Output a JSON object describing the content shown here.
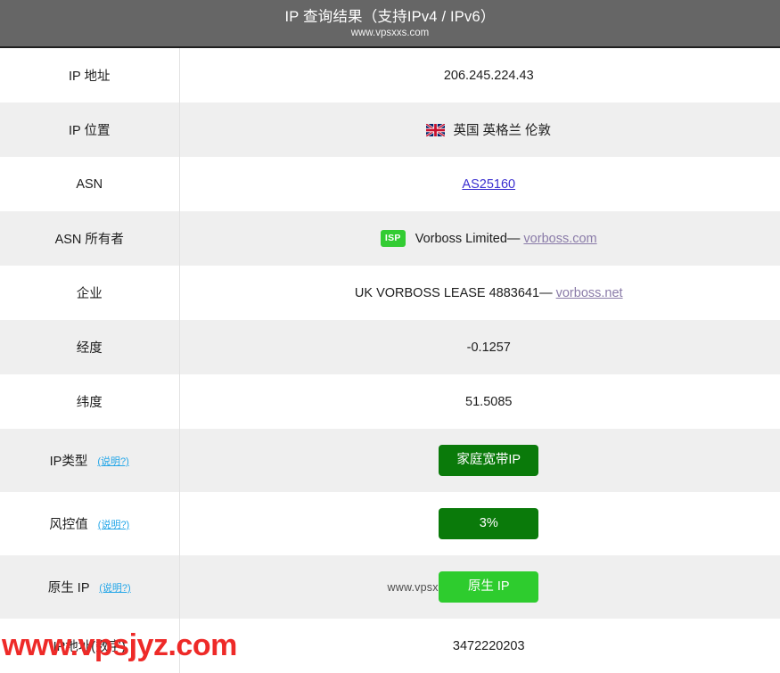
{
  "header": {
    "title": "IP 查询结果（支持IPv4 / IPv6）",
    "subtitle": "www.vpsxxs.com",
    "bg_color": "#666666",
    "title_color": "#ffffff"
  },
  "colors": {
    "row_odd": "#ffffff",
    "row_even": "#efefef",
    "divider": "#e2e2e2",
    "link_asn": "#3b2fd0",
    "link_visited": "#8a7ba8",
    "note_link": "#23a6e8",
    "badge_isp_green": "#33cc33",
    "badge_dark_green": "#0a7a0a",
    "badge_bright_green": "#2ecc2e",
    "watermark_red": "#ee2a28",
    "watermark_gray": "#4d4d4d"
  },
  "note_label": "(说明?)",
  "rows": {
    "ip_address": {
      "label": "IP 地址",
      "value": "206.245.224.43"
    },
    "ip_location": {
      "label": "IP 位置",
      "value": "英国 英格兰 伦敦",
      "flag_icon": "uk-flag-icon"
    },
    "asn": {
      "label": "ASN",
      "value": "AS25160"
    },
    "asn_owner": {
      "label": "ASN 所有者",
      "badge": "ISP",
      "value": "Vorboss Limited—",
      "link": "vorboss.com"
    },
    "organization": {
      "label": "企业",
      "value": "UK VORBOSS LEASE 4883641—",
      "link": "vorboss.net"
    },
    "longitude": {
      "label": "经度",
      "value": "-0.1257"
    },
    "latitude": {
      "label": "纬度",
      "value": "51.5085"
    },
    "ip_type": {
      "label": "IP类型",
      "note": "(说明?)",
      "badge_value": "家庭宽带IP",
      "badge_color": "#0a7a0a"
    },
    "risk_score": {
      "label": "风控值",
      "note": "(说明?)",
      "badge_value": "3%",
      "badge_color": "#0a7a0a"
    },
    "native_ip": {
      "label": "原生 IP",
      "note": "(说明?)",
      "badge_value": "原生 IP",
      "badge_color": "#2ecc2e",
      "watermark": "www.vpsxxs.com"
    },
    "ip_numeric": {
      "label": "IP地址(数字)",
      "value": "3472220203"
    }
  },
  "overlay_watermark": "www.vpsjyz.com"
}
